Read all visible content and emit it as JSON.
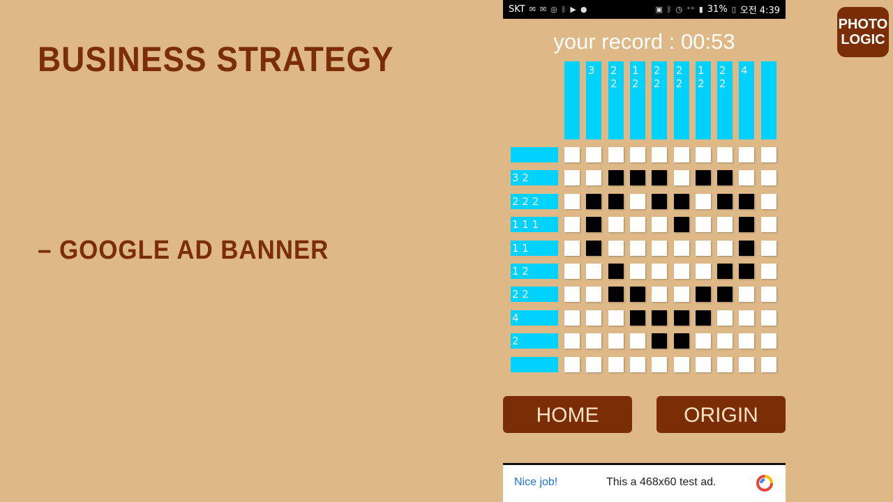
{
  "slide": {
    "title": "BUSINESS STRATEGY",
    "subtitle": "– GOOGLE AD BANNER"
  },
  "logo": {
    "line1": "PHOTO",
    "line2": "LOGIC"
  },
  "statusbar": {
    "carrier": "SKT",
    "battery": "31%",
    "time": "오전 4:39",
    "left_icons": [
      "gmail-icon",
      "mail-icon",
      "instagram-icon",
      "bluetooth-icon",
      "play-icon",
      "chat-icon"
    ],
    "right_icons": [
      "lock-icon",
      "bluetooth-icon",
      "alarm-icon",
      "lte-icon",
      "signal-icon",
      "battery-icon"
    ]
  },
  "game": {
    "record": "your record : 00:53",
    "col_clues": [
      "",
      "3",
      "2\n2",
      "1\n2",
      "2\n2",
      "2\n2",
      "1\n2",
      "2\n2",
      "4",
      ""
    ],
    "row_clues": [
      "",
      "3 2",
      "2 2 2",
      "1 1 1",
      "1 1",
      "1 2",
      "2 2",
      "4",
      "2",
      ""
    ],
    "grid": [
      [
        0,
        0,
        0,
        0,
        0,
        0,
        0,
        0,
        0,
        0
      ],
      [
        0,
        0,
        1,
        1,
        1,
        0,
        1,
        1,
        0,
        0
      ],
      [
        0,
        1,
        1,
        0,
        1,
        1,
        0,
        1,
        1,
        0
      ],
      [
        0,
        1,
        0,
        0,
        0,
        1,
        0,
        0,
        1,
        0
      ],
      [
        0,
        1,
        0,
        0,
        0,
        0,
        0,
        0,
        1,
        0
      ],
      [
        0,
        0,
        1,
        0,
        0,
        0,
        0,
        1,
        1,
        0
      ],
      [
        0,
        0,
        1,
        1,
        0,
        0,
        1,
        1,
        0,
        0
      ],
      [
        0,
        0,
        0,
        1,
        1,
        1,
        1,
        0,
        0,
        0
      ],
      [
        0,
        0,
        0,
        0,
        1,
        1,
        0,
        0,
        0,
        0
      ],
      [
        0,
        0,
        0,
        0,
        0,
        0,
        0,
        0,
        0,
        0
      ]
    ]
  },
  "buttons": {
    "home": "HOME",
    "origin": "ORIGIN"
  },
  "ad": {
    "nice": "Nice job!",
    "message": "This a 468x60 test ad.",
    "icon": "ad-choices-icon"
  },
  "colors": {
    "background": "#deb887",
    "brand": "#7b2d05",
    "clue": "#00d2ff",
    "filled": "#000000",
    "empty": "#ffffff"
  }
}
